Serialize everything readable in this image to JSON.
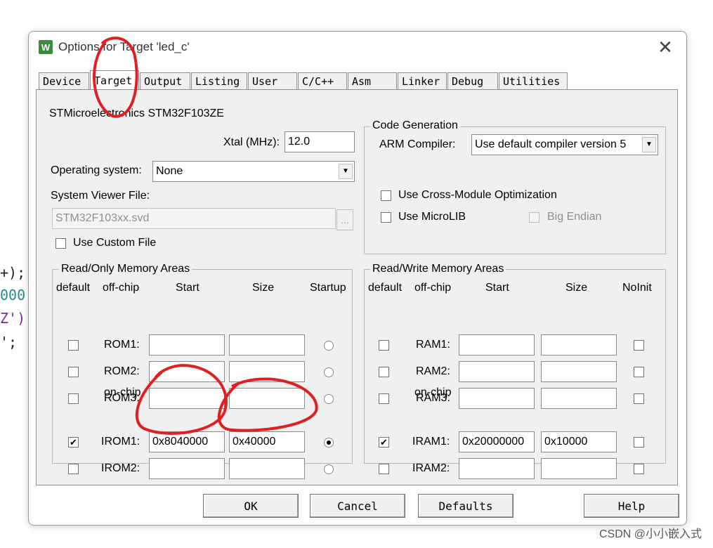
{
  "background_code": {
    "lines": [
      "+);",
      "000",
      "Z')",
      "';"
    ],
    "colors": [
      "#222222",
      "#2a8a8a",
      "#7a2a9a",
      "#222222"
    ]
  },
  "dialog": {
    "title": "Options for Target 'led_c'",
    "icon_label": "W"
  },
  "tabs": [
    "Device",
    "Target",
    "Output",
    "Listing",
    "User",
    "C/C++",
    "Asm",
    "Linker",
    "Debug",
    "Utilities"
  ],
  "active_tab": "Target",
  "target": {
    "device_name": "STMicroelectronics STM32F103ZE",
    "xtal_label": "Xtal (MHz):",
    "xtal_value": "12.0",
    "os_label": "Operating system:",
    "os_value": "None",
    "svf_label": "System Viewer File:",
    "svf_value": "STM32F103xx.svd",
    "browse_label": "...",
    "use_custom_label": "Use Custom File"
  },
  "code_generation": {
    "title": "Code Generation",
    "compiler_label": "ARM Compiler:",
    "compiler_value": "Use default compiler version 5",
    "cross_module_label": "Use Cross-Module Optimization",
    "microlib_label": "Use MicroLIB",
    "big_endian_label": "Big Endian"
  },
  "ro_memory": {
    "title": "Read/Only Memory Areas",
    "headers": {
      "default": "default",
      "offchip": "off-chip",
      "start": "Start",
      "size": "Size",
      "startup": "Startup"
    },
    "onchip_label": "on-chip",
    "rows": [
      {
        "name": "ROM1:",
        "start": "",
        "size": "",
        "default": false,
        "startup": false
      },
      {
        "name": "ROM2:",
        "start": "",
        "size": "",
        "default": false,
        "startup": false
      },
      {
        "name": "ROM3:",
        "start": "",
        "size": "",
        "default": false,
        "startup": false
      },
      {
        "name": "IROM1:",
        "start": "0x8040000",
        "size": "0x40000",
        "default": true,
        "startup": true
      },
      {
        "name": "IROM2:",
        "start": "",
        "size": "",
        "default": false,
        "startup": false
      }
    ]
  },
  "rw_memory": {
    "title": "Read/Write Memory Areas",
    "headers": {
      "default": "default",
      "offchip": "off-chip",
      "start": "Start",
      "size": "Size",
      "noinit": "NoInit"
    },
    "onchip_label": "on-chip",
    "rows": [
      {
        "name": "RAM1:",
        "start": "",
        "size": "",
        "default": false,
        "noinit": false
      },
      {
        "name": "RAM2:",
        "start": "",
        "size": "",
        "default": false,
        "noinit": false
      },
      {
        "name": "RAM3:",
        "start": "",
        "size": "",
        "default": false,
        "noinit": false
      },
      {
        "name": "IRAM1:",
        "start": "0x20000000",
        "size": "0x10000",
        "default": true,
        "noinit": false
      },
      {
        "name": "IRAM2:",
        "start": "",
        "size": "",
        "default": false,
        "noinit": false
      }
    ]
  },
  "buttons": {
    "ok": "OK",
    "cancel": "Cancel",
    "defaults": "Defaults",
    "help": "Help"
  },
  "watermark": "CSDN @小小嵌入式",
  "annotation_color": "#e02020"
}
